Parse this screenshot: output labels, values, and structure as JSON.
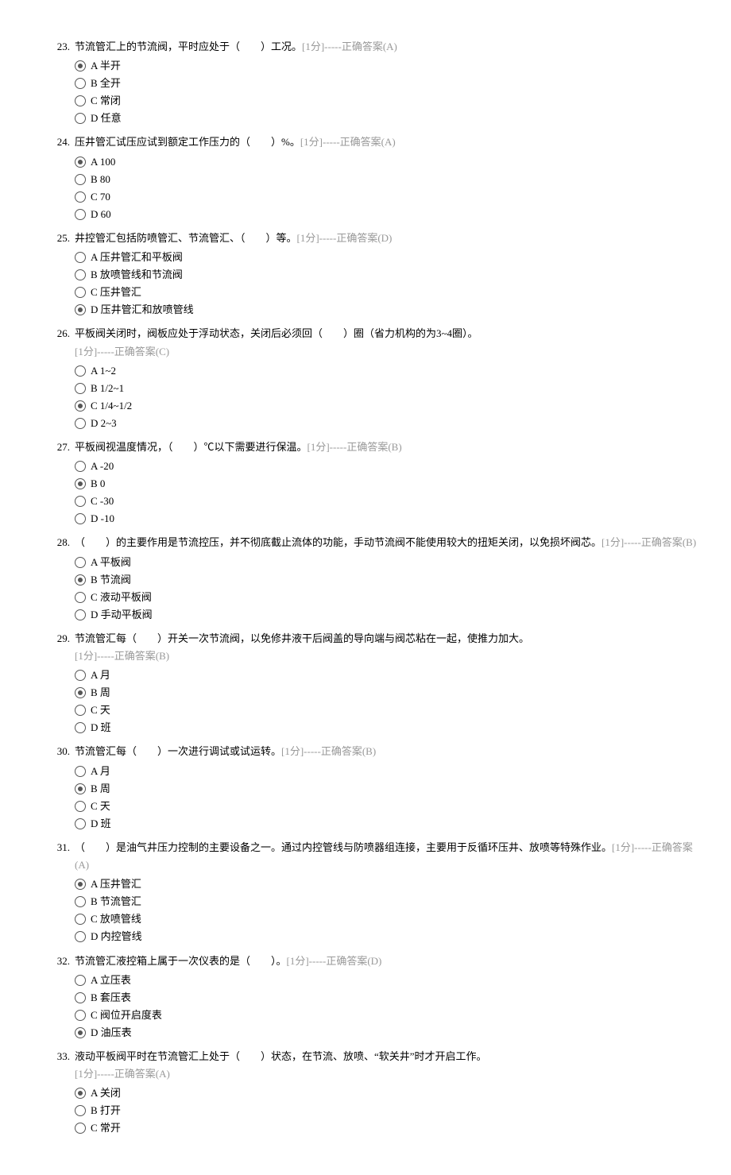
{
  "questions": [
    {
      "num": "23.",
      "text": "节流管汇上的节流阀，平时应处于（　　）工况。",
      "meta": "[1分]-----正确答案(A)",
      "metaInline": true,
      "correct": "A",
      "options": [
        {
          "label": "A  半开",
          "selected": true
        },
        {
          "label": "B  全开",
          "selected": false
        },
        {
          "label": "C  常闭",
          "selected": false
        },
        {
          "label": "D  任意",
          "selected": false
        }
      ]
    },
    {
      "num": "24.",
      "text": "压井管汇试压应试到额定工作压力的（　　）%。",
      "meta": "[1分]-----正确答案(A)",
      "metaInline": true,
      "correct": "A",
      "options": [
        {
          "label": "A  100",
          "selected": true
        },
        {
          "label": "B  80",
          "selected": false
        },
        {
          "label": "C  70",
          "selected": false
        },
        {
          "label": "D  60",
          "selected": false
        }
      ]
    },
    {
      "num": "25.",
      "text": "井控管汇包括防喷管汇、节流管汇、（　　）等。",
      "meta": "[1分]-----正确答案(D)",
      "metaInline": true,
      "correct": "D",
      "options": [
        {
          "label": "A  压井管汇和平板阀",
          "selected": false
        },
        {
          "label": "B  放喷管线和节流阀",
          "selected": false
        },
        {
          "label": "C  压井管汇",
          "selected": false
        },
        {
          "label": "D  压井管汇和放喷管线",
          "selected": true
        }
      ]
    },
    {
      "num": "26.",
      "text": "平板阀关闭时，阀板应处于浮动状态，关闭后必须回（　　）圈（省力机构的为3~4圈）。",
      "meta": "[1分]-----正确答案(C)",
      "metaInline": false,
      "correct": "C",
      "options": [
        {
          "label": "A  1~2",
          "selected": false
        },
        {
          "label": "B  1/2~1",
          "selected": false
        },
        {
          "label": "C  1/4~1/2",
          "selected": true
        },
        {
          "label": "D  2~3",
          "selected": false
        }
      ]
    },
    {
      "num": "27.",
      "text": "平板阀视温度情况，（　　）℃以下需要进行保温。",
      "meta": "[1分]-----正确答案(B)",
      "metaInline": true,
      "correct": "B",
      "options": [
        {
          "label": "A  -20",
          "selected": false
        },
        {
          "label": "B  0",
          "selected": true
        },
        {
          "label": "C  -30",
          "selected": false
        },
        {
          "label": "D  -10",
          "selected": false
        }
      ]
    },
    {
      "num": "28.",
      "text": "（　　）的主要作用是节流控压，并不彻底截止流体的功能，手动节流阀不能使用较大的扭矩关闭，以免损坏阀芯。",
      "meta": "[1分]-----正确答案(B)",
      "metaInline": true,
      "correct": "B",
      "options": [
        {
          "label": "A  平板阀",
          "selected": false
        },
        {
          "label": "B  节流阀",
          "selected": true
        },
        {
          "label": "C  液动平板阀",
          "selected": false
        },
        {
          "label": "D  手动平板阀",
          "selected": false
        }
      ]
    },
    {
      "num": "29.",
      "text": "节流管汇每（　　）开关一次节流阀，以免修井液干后阀盖的导向端与阀芯粘在一起，使推力加大。",
      "meta": "[1分]-----正确答案(B)",
      "metaInline": false,
      "correct": "B",
      "options": [
        {
          "label": "A  月",
          "selected": false
        },
        {
          "label": "B  周",
          "selected": true
        },
        {
          "label": "C  天",
          "selected": false
        },
        {
          "label": "D  班",
          "selected": false
        }
      ]
    },
    {
      "num": "30.",
      "text": "节流管汇每（　　）一次进行调试或试运转。",
      "meta": "[1分]-----正确答案(B)",
      "metaInline": true,
      "correct": "B",
      "options": [
        {
          "label": "A  月",
          "selected": false
        },
        {
          "label": "B  周",
          "selected": true
        },
        {
          "label": "C  天",
          "selected": false
        },
        {
          "label": "D  班",
          "selected": false
        }
      ]
    },
    {
      "num": "31.",
      "text": "（　　）是油气井压力控制的主要设备之一。通过内控管线与防喷器组连接，主要用于反循环压井、放喷等特殊作业。",
      "meta": "[1分]-----正确答案(A)",
      "metaInline": true,
      "correct": "A",
      "options": [
        {
          "label": "A  压井管汇",
          "selected": true
        },
        {
          "label": "B  节流管汇",
          "selected": false
        },
        {
          "label": "C  放喷管线",
          "selected": false
        },
        {
          "label": "D  内控管线",
          "selected": false
        }
      ]
    },
    {
      "num": "32.",
      "text": "节流管汇液控箱上属于一次仪表的是（　　）。",
      "meta": "[1分]-----正确答案(D)",
      "metaInline": true,
      "correct": "D",
      "options": [
        {
          "label": "A  立压表",
          "selected": false
        },
        {
          "label": "B  套压表",
          "selected": false
        },
        {
          "label": "C  阀位开启度表",
          "selected": false
        },
        {
          "label": "D  油压表",
          "selected": true
        }
      ]
    },
    {
      "num": "33.",
      "text": "液动平板阀平时在节流管汇上处于（　　）状态，在节流、放喷、“软关井”时才开启工作。",
      "meta": "[1分]-----正确答案(A)",
      "metaInline": false,
      "correct": "A",
      "options": [
        {
          "label": "A  关闭",
          "selected": true
        },
        {
          "label": "B  打开",
          "selected": false
        },
        {
          "label": "C  常开",
          "selected": false
        }
      ]
    }
  ]
}
